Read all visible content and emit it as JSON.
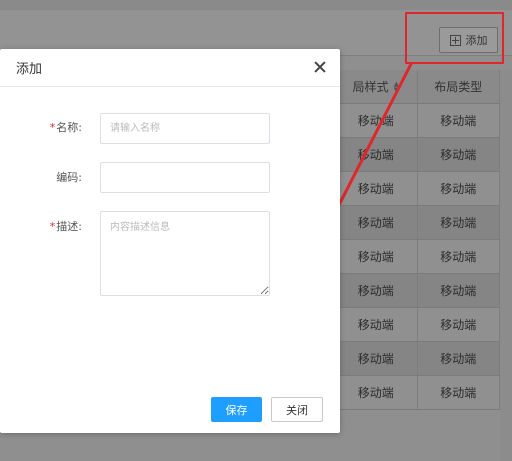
{
  "toolbar": {
    "add_label": "添加"
  },
  "table": {
    "headers": [
      "局样式",
      "布局类型"
    ],
    "rows": [
      [
        "移动端",
        "移动端"
      ],
      [
        "移动端",
        "移动端"
      ],
      [
        "移动端",
        "移动端"
      ],
      [
        "移动端",
        "移动端"
      ],
      [
        "移动端",
        "移动端"
      ],
      [
        "移动端",
        "移动端"
      ],
      [
        "移动端",
        "移动端"
      ],
      [
        "移动端",
        "移动端"
      ],
      [
        "移动端",
        "移动端"
      ]
    ]
  },
  "modal": {
    "title": "添加",
    "fields": {
      "name_label": "名称:",
      "name_placeholder": "请输入名称",
      "code_label": "编码:",
      "code_value": "",
      "desc_label": "描述:",
      "desc_placeholder": "内容描述信息"
    },
    "save_label": "保存",
    "close_label": "关闭"
  },
  "colors": {
    "primary": "#1e9fff",
    "annotation": "#e0262b",
    "required": "#e0262b"
  },
  "icons": [
    "plus-square-icon",
    "close-icon",
    "sort-icon"
  ]
}
